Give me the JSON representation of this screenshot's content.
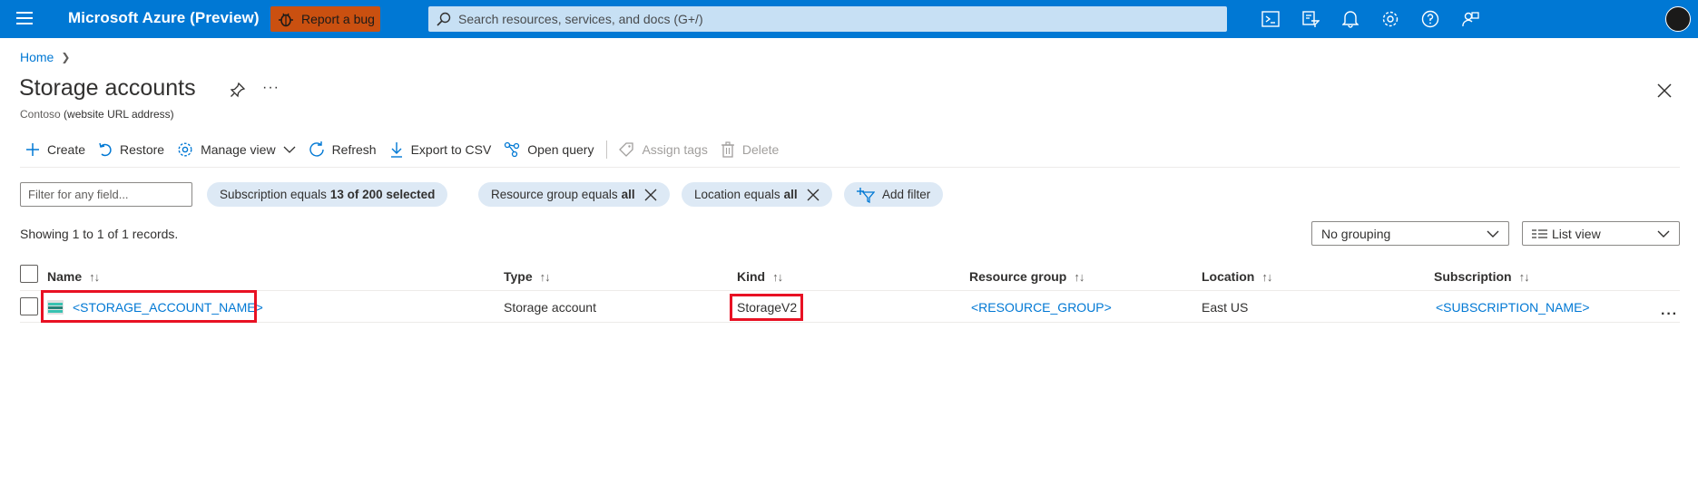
{
  "app": {
    "title": "Microsoft Azure (Preview)",
    "report_bug": "Report a bug",
    "search_placeholder": "Search resources, services, and docs (G+/)"
  },
  "breadcrumb": {
    "home": "Home"
  },
  "page": {
    "title": "Storage accounts",
    "tenant": "Contoso",
    "tenant_note": "(website URL address)",
    "more": "···"
  },
  "toolbar": {
    "create": "Create",
    "restore": "Restore",
    "manage_view": "Manage view",
    "refresh": "Refresh",
    "export_csv": "Export to CSV",
    "open_query": "Open query",
    "assign_tags": "Assign tags",
    "delete": "Delete"
  },
  "filters": {
    "placeholder": "Filter for any field...",
    "subscription_label": "Subscription equals",
    "subscription_value": "13 of 200 selected",
    "resource_group_label": "Resource group equals",
    "resource_group_value": "all",
    "location_label": "Location equals",
    "location_value": "all",
    "add_filter": "Add filter"
  },
  "records": "Showing 1 to 1 of  1  records.",
  "grouping": {
    "selected": "No grouping"
  },
  "view": {
    "selected": "List view"
  },
  "table": {
    "headers": {
      "name": "Name",
      "type": "Type",
      "kind": "Kind",
      "resource_group": "Resource group",
      "location": "Location",
      "subscription": "Subscription"
    },
    "sort_glyph": "↑↓",
    "rows": [
      {
        "name": "<STORAGE_ACCOUNT_NAME>",
        "type": "Storage account",
        "kind": "StorageV2",
        "resource_group": "<RESOURCE_GROUP>",
        "location": "East US",
        "subscription": "<SUBSCRIPTION_NAME>"
      }
    ],
    "row_more": "···"
  },
  "colors": {
    "azure_blue": "#0078d4",
    "bug_orange": "#ca5010",
    "highlight_red": "#e81123",
    "pill_bg": "#dde9f5"
  },
  "icons": [
    "hamburger-icon",
    "bug-icon",
    "search-icon",
    "cloud-shell-icon",
    "directory-filter-icon",
    "bell-icon",
    "gear-icon",
    "help-icon",
    "feedback-icon",
    "pin-icon",
    "close-icon",
    "plus-icon",
    "restore-icon",
    "gear-icon",
    "refresh-icon",
    "download-icon",
    "query-icon",
    "tag-icon",
    "trash-icon",
    "add-filter-icon",
    "storage-account-icon"
  ]
}
